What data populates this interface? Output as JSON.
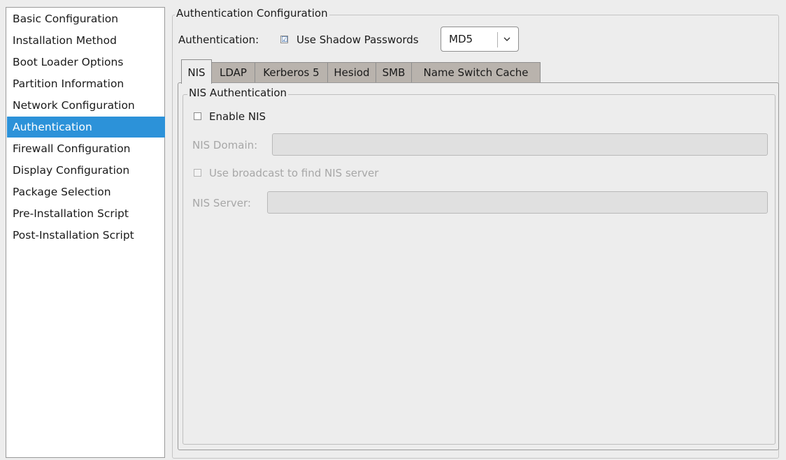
{
  "sidebar": {
    "items": [
      {
        "label": "Basic Configuration"
      },
      {
        "label": "Installation Method"
      },
      {
        "label": "Boot Loader Options"
      },
      {
        "label": "Partition Information"
      },
      {
        "label": "Network Configuration"
      },
      {
        "label": "Authentication"
      },
      {
        "label": "Firewall Configuration"
      },
      {
        "label": "Display Configuration"
      },
      {
        "label": "Package Selection"
      },
      {
        "label": "Pre-Installation Script"
      },
      {
        "label": "Post-Installation Script"
      }
    ],
    "selected": "Authentication"
  },
  "auth": {
    "frame_title": "Authentication Configuration",
    "label": "Authentication:",
    "shadow_label": "Use Shadow Passwords",
    "shadow_checked": true,
    "hash_value": "MD5"
  },
  "tabs": [
    {
      "label": "NIS"
    },
    {
      "label": "LDAP"
    },
    {
      "label": "Kerberos 5"
    },
    {
      "label": "Hesiod"
    },
    {
      "label": "SMB"
    },
    {
      "label": "Name Switch Cache"
    }
  ],
  "active_tab": "NIS",
  "nis": {
    "frame_title": "NIS Authentication",
    "enable_label": "Enable NIS",
    "enable_checked": false,
    "domain_label": "NIS Domain:",
    "domain_value": "",
    "broadcast_label": "Use broadcast to find NIS server",
    "broadcast_checked": false,
    "server_label": "NIS Server:",
    "server_value": ""
  },
  "icons": {
    "check": "☑",
    "dropdown": "chevron-down-icon"
  }
}
